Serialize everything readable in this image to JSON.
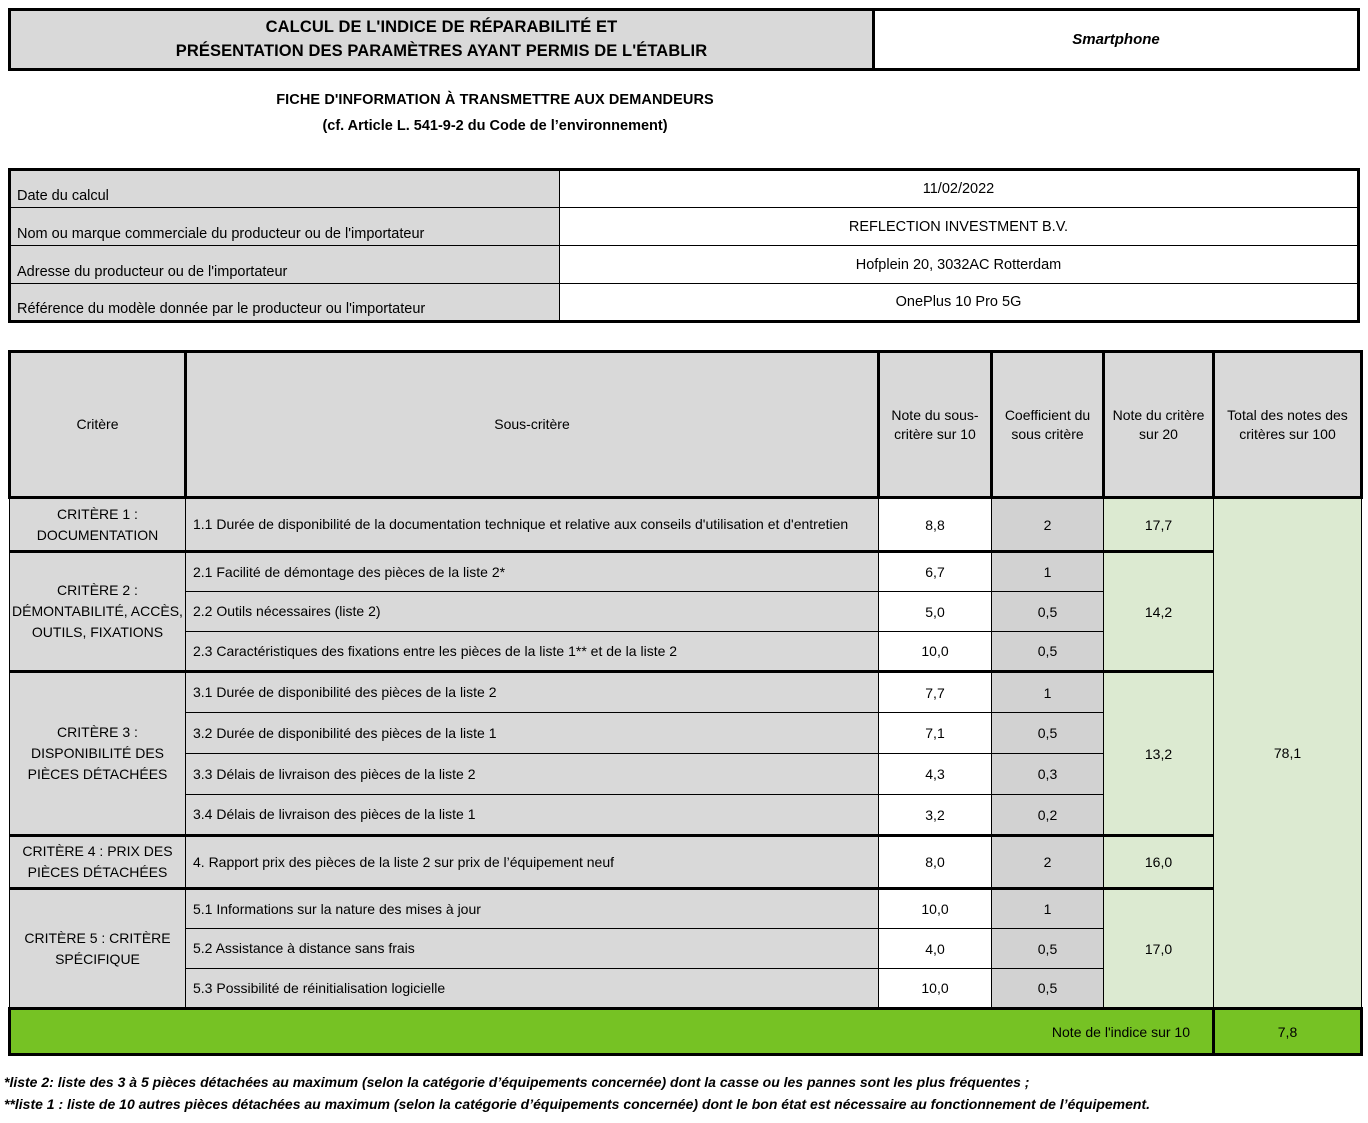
{
  "header": {
    "title_line1": "CALCUL DE L'INDICE DE RÉPARABILITÉ ET",
    "title_line2": "PRÉSENTATION DES PARAMÈTRES AYANT PERMIS DE L'ÉTABLIR",
    "device_category": "Smartphone",
    "subtitle_line1": "FICHE D'INFORMATION À TRANSMETTRE AUX DEMANDEURS",
    "subtitle_line2": "(cf. Article L. 541-9-2 du Code de l’environnement)"
  },
  "info_table": {
    "rows": [
      {
        "label": "Date du calcul",
        "value": "11/02/2022"
      },
      {
        "label": "Nom ou marque commerciale du producteur ou de l'importateur",
        "value": "REFLECTION INVESTMENT B.V."
      },
      {
        "label": "Adresse du producteur ou de l'importateur",
        "value": "Hofplein 20, 3032AC Rotterdam"
      },
      {
        "label": "Référence du modèle donnée par le producteur ou l'importateur",
        "value": "OnePlus 10 Pro 5G"
      }
    ]
  },
  "main_table": {
    "headers": {
      "critere": "Critère",
      "sous_critere": "Sous-critère",
      "note_sous_critere": "Note du sous-critère sur 10",
      "coefficient": "Coefficient du sous critère",
      "note_critere": "Note du critère sur 20",
      "total": "Total des notes des critères sur 100"
    },
    "total_value": "78,1",
    "groups": [
      {
        "criterion": "CRITÈRE 1 : DOCUMENTATION",
        "note_critere_20": "17,7",
        "subcriteria": [
          {
            "label": "1.1 Durée de disponibilité de la documentation technique et relative aux conseils d'utilisation et d'entretien",
            "note": "8,8",
            "coef": "2"
          }
        ]
      },
      {
        "criterion": "CRITÈRE 2 : DÉMONTABILITÉ, ACCÈS, OUTILS, FIXATIONS",
        "note_critere_20": "14,2",
        "subcriteria": [
          {
            "label": "2.1 Facilité de démontage des pièces de la liste 2*",
            "note": "6,7",
            "coef": "1"
          },
          {
            "label": "2.2 Outils nécessaires (liste 2)",
            "note": "5,0",
            "coef": "0,5"
          },
          {
            "label": "2.3 Caractéristiques des fixations entre les pièces de la liste 1** et de la liste 2",
            "note": "10,0",
            "coef": "0,5"
          }
        ]
      },
      {
        "criterion": "CRITÈRE 3 : DISPONIBILITÉ DES PIÈCES DÉTACHÉES",
        "note_critere_20": "13,2",
        "subcriteria": [
          {
            "label": "3.1 Durée de disponibilité des pièces de la liste 2",
            "note": "7,7",
            "coef": "1"
          },
          {
            "label": "3.2 Durée de disponibilité des pièces de la liste 1",
            "note": "7,1",
            "coef": "0,5"
          },
          {
            "label": "3.3 Délais de livraison des pièces de la liste 2",
            "note": "4,3",
            "coef": "0,3"
          },
          {
            "label": "3.4 Délais de livraison des pièces de la liste 1",
            "note": "3,2",
            "coef": "0,2"
          }
        ]
      },
      {
        "criterion": "CRITÈRE 4 : PRIX DES PIÈCES DÉTACHÉES",
        "note_critere_20": "16,0",
        "subcriteria": [
          {
            "label": "4. Rapport prix des pièces de la liste 2 sur prix de l’équipement neuf",
            "note": "8,0",
            "coef": "2"
          }
        ]
      },
      {
        "criterion": "CRITÈRE 5 : CRITÈRE SPÉCIFIQUE",
        "note_critere_20": "17,0",
        "subcriteria": [
          {
            "label": "5.1 Informations sur la nature des mises à jour",
            "note": "10,0",
            "coef": "1"
          },
          {
            "label": "5.2 Assistance à distance sans frais",
            "note": "4,0",
            "coef": "0,5"
          },
          {
            "label": "5.3 Possibilité de réinitialisation logicielle",
            "note": "10,0",
            "coef": "0,5"
          }
        ]
      }
    ]
  },
  "score": {
    "label": "Note de l'indice sur 10",
    "value": "7,8"
  },
  "footnotes": [
    "*liste 2: liste des 3 à 5 pièces détachées au maximum (selon la catégorie d’équipements concernée) dont la casse ou les pannes sont les plus fréquentes ;",
    "**liste 1 : liste de 10 autres pièces détachées au maximum (selon la catégorie d’équipements concernée) dont le bon état est nécessaire au fonctionnement de l’équipement."
  ],
  "colors": {
    "header_gray": "#d9d9d9",
    "coef_gray": "#d2d2d2",
    "light_green": "#dcead1",
    "score_green": "#76c224"
  }
}
